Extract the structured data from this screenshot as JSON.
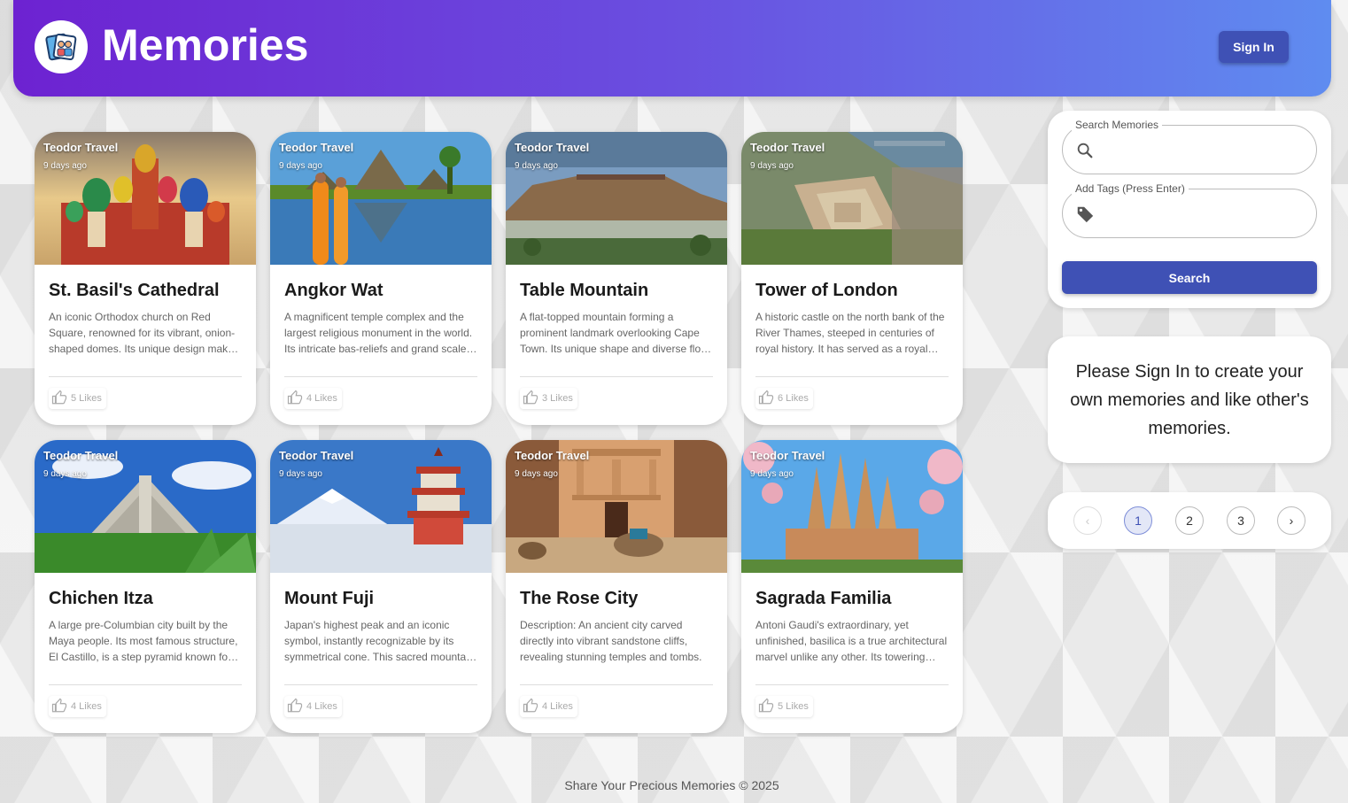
{
  "header": {
    "brand": "Memories",
    "signin_label": "Sign In"
  },
  "posts": [
    {
      "title": "St. Basil's Cathedral",
      "author": "Teodor Travel",
      "time": "9 days ago",
      "description": "An iconic Orthodox church on Red Square, renowned for its vibrant, onion-shaped domes. Its unique design makes it a symbol of Russia.",
      "likes": "5 Likes",
      "image": "cathedral-domes"
    },
    {
      "title": "Angkor Wat",
      "author": "Teodor Travel",
      "time": "9 days ago",
      "description": "A magnificent temple complex and the largest religious monument in the world. Its intricate bas-reliefs and grand scale amaze visitors.",
      "likes": "4 Likes",
      "image": "temple-reflection"
    },
    {
      "title": "Table Mountain",
      "author": "Teodor Travel",
      "time": "9 days ago",
      "description": "A flat-topped mountain forming a prominent landmark overlooking Cape Town. Its unique shape and diverse flora attract hikers.",
      "likes": "3 Likes",
      "image": "flat-mountain"
    },
    {
      "title": "Tower of London",
      "author": "Teodor Travel",
      "time": "9 days ago",
      "description": "A historic castle on the north bank of the River Thames, steeped in centuries of royal history. It has served as a royal palace.",
      "likes": "6 Likes",
      "image": "castle-aerial"
    },
    {
      "title": "Chichen Itza",
      "author": "Teodor Travel",
      "time": "9 days ago",
      "description": "A large pre-Columbian city built by the Maya people. Its most famous structure, El Castillo, is a step pyramid known for its acoustics.",
      "likes": "4 Likes",
      "image": "step-pyramid"
    },
    {
      "title": "Mount Fuji",
      "author": "Teodor Travel",
      "time": "9 days ago",
      "description": "Japan's highest peak and an iconic symbol, instantly recognizable by its symmetrical cone. This sacred mountain inspires artists.",
      "likes": "4 Likes",
      "image": "snow-mountain-pagoda"
    },
    {
      "title": "The Rose City",
      "author": "Teodor Travel",
      "time": "9 days ago",
      "description": "Description: An ancient city carved directly into vibrant sandstone cliffs, revealing stunning temples and tombs.",
      "likes": "4 Likes",
      "image": "rock-temple-camel"
    },
    {
      "title": "Sagrada Familia",
      "author": "Teodor Travel",
      "time": "9 days ago",
      "description": "Antoni Gaudi's extraordinary, yet unfinished, basilica is a true architectural marvel unlike any other. Its towering spires rise above Barcelona.",
      "likes": "5 Likes",
      "image": "basilica-spires"
    }
  ],
  "search": {
    "search_label": "Search Memories",
    "search_value": "",
    "tags_label": "Add Tags (Press Enter)",
    "tags_value": "",
    "button_label": "Search"
  },
  "notice": {
    "text": "Please Sign In to create your own memories and like other's memories."
  },
  "pagination": {
    "prev": "‹",
    "pages": [
      "1",
      "2",
      "3"
    ],
    "current": "1",
    "next": "›"
  },
  "footer": {
    "text": "Share Your Precious Memories © 2025"
  },
  "colors": {
    "primary": "#3f51b5",
    "header_start": "#6d22d1",
    "header_end": "#5f8cf0"
  }
}
